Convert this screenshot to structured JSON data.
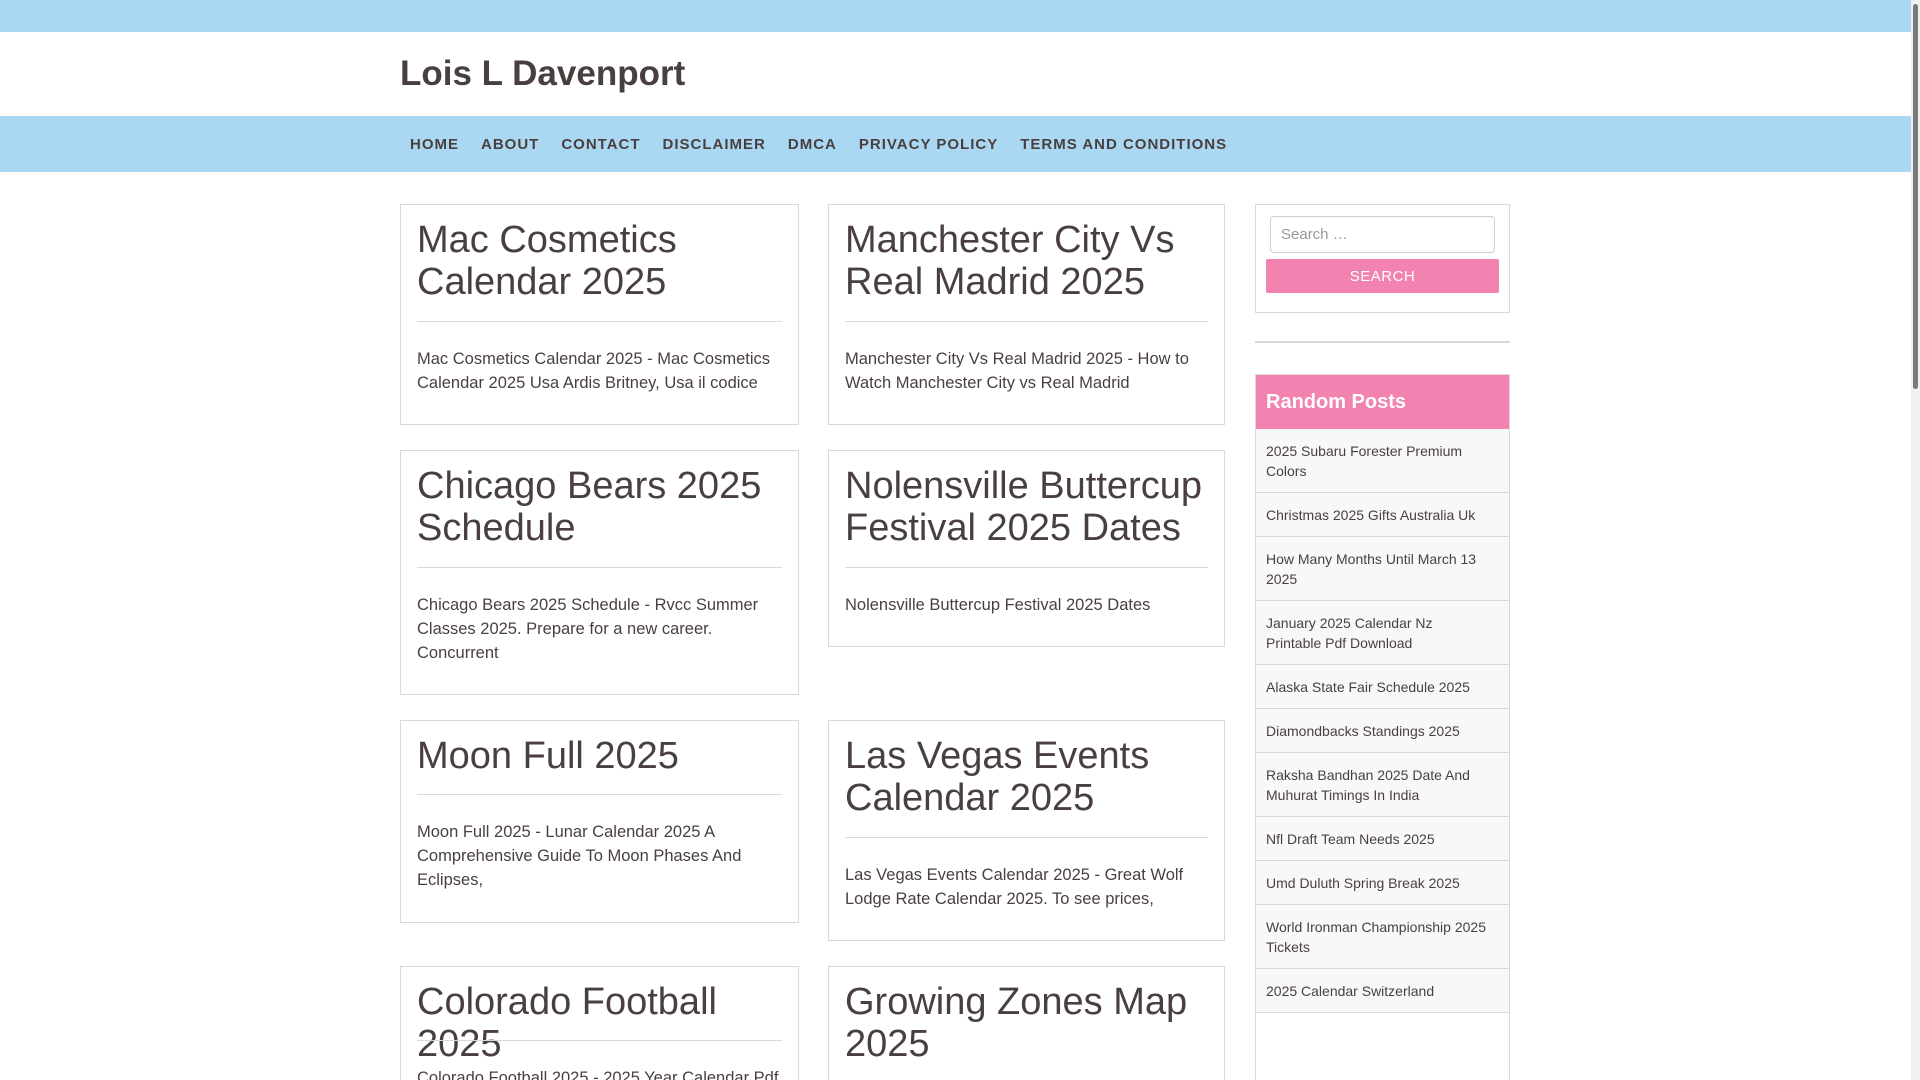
{
  "site": {
    "title": "Lois L Davenport"
  },
  "nav": {
    "items": [
      {
        "label": "HOME"
      },
      {
        "label": "ABOUT"
      },
      {
        "label": "CONTACT"
      },
      {
        "label": "DISCLAIMER"
      },
      {
        "label": "DMCA"
      },
      {
        "label": "PRIVACY POLICY"
      },
      {
        "label": "TERMS AND CONDITIONS"
      }
    ]
  },
  "posts": [
    {
      "title": "Mac Cosmetics Calendar 2025",
      "excerpt": "Mac Cosmetics Calendar 2025 - Mac Cosmetics Calendar 2025 Usa Ardis Britney, Usa il codice"
    },
    {
      "title": "Manchester City Vs Real Madrid 2025",
      "excerpt": "Manchester City Vs Real Madrid 2025 - How to Watch Manchester City vs Real Madrid"
    },
    {
      "title": "Chicago Bears 2025 Schedule",
      "excerpt": "Chicago Bears 2025 Schedule - Rvcc Summer Classes 2025. Prepare for a new career. Concurrent"
    },
    {
      "title": "Nolensville Buttercup Festival 2025 Dates",
      "excerpt": "Nolensville Buttercup Festival 2025 Dates"
    },
    {
      "title": "Moon Full 2025",
      "excerpt": "Moon Full 2025 - Lunar Calendar 2025 A Comprehensive Guide To Moon Phases And Eclipses,"
    },
    {
      "title": "Las Vegas Events Calendar 2025",
      "excerpt": "Las Vegas Events Calendar 2025 - Great Wolf Lodge Rate Calendar 2025. To see prices,"
    },
    {
      "title": "Colorado Football 2025",
      "excerpt": "Colorado Football 2025 - 2025 Year Calendar Pdf"
    },
    {
      "title": "Growing Zones Map 2025",
      "excerpt": ""
    }
  ],
  "search": {
    "placeholder": "Search …",
    "button_label": "SEARCH"
  },
  "random_posts": {
    "heading": "Random Posts",
    "items": [
      {
        "label": "2025 Subaru Forester Premium Colors"
      },
      {
        "label": "Christmas 2025 Gifts Australia Uk"
      },
      {
        "label": "How Many Months Until March 13 2025"
      },
      {
        "label": "January 2025 Calendar Nz Printable Pdf Download"
      },
      {
        "label": "Alaska State Fair Schedule 2025"
      },
      {
        "label": "Diamondbacks Standings 2025"
      },
      {
        "label": "Raksha Bandhan 2025 Date And Muhurat Timings In India"
      },
      {
        "label": "Nfl Draft Team Needs 2025"
      },
      {
        "label": "Umd Duluth Spring Break 2025"
      },
      {
        "label": "World Ironman Championship 2025 Tickets"
      },
      {
        "label": "2025 Calendar Switzerland"
      }
    ]
  },
  "colors": {
    "nav_bg": "#aad8f2",
    "accent": "#f283b0",
    "text": "#4a3f3f"
  }
}
